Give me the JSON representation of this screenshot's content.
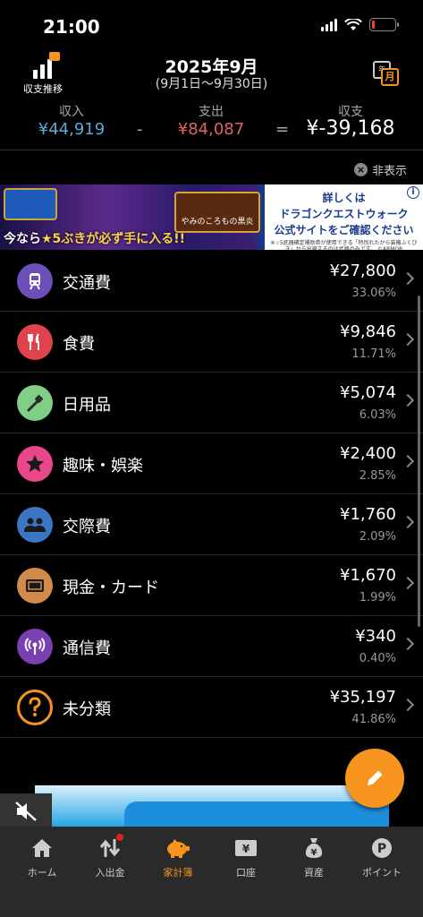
{
  "status_bar": {
    "time": "21:00"
  },
  "header": {
    "trend_label": "収支推移",
    "month_title": "2025年9月",
    "date_range": "(9月1日〜9月30日)",
    "calendar_back": "年",
    "calendar_front": "月"
  },
  "summary": {
    "income_label": "収入",
    "income_value": "¥44,919",
    "minus_sign": "-",
    "expense_label": "支出",
    "expense_value": "¥84,087",
    "equals_sign": "=",
    "balance_label": "収支",
    "balance_value": "¥-39,168"
  },
  "ad": {
    "hide_label": "非表示",
    "left_text_a": "今なら",
    "left_text_b": "★5ぶきが必ず手に入る!!",
    "badge_text": "やみのころもの黒炎",
    "right_line1": "詳しくは",
    "right_line2": "ドラゴンクエストウォーク",
    "right_line3": "公式サイトをご確認ください",
    "right_small": "※☆5武器確定補助券が使用できる「特別れたから装備ふくびき」から出現するのは武器のみです。 ©ARMOR PROJECT/BIRD STUDIO/SQUARE ENIX"
  },
  "categories": [
    {
      "name": "交通費",
      "amount": "¥27,800",
      "percent": "33.06%",
      "color": "#6a4fb8",
      "icon": "train-icon"
    },
    {
      "name": "食費",
      "amount": "¥9,846",
      "percent": "11.71%",
      "color": "#e0434b",
      "icon": "fork-knife-icon"
    },
    {
      "name": "日用品",
      "amount": "¥5,074",
      "percent": "6.03%",
      "color": "#7fcf86",
      "icon": "toothbrush-icon"
    },
    {
      "name": "趣味・娯楽",
      "amount": "¥2,400",
      "percent": "2.85%",
      "color": "#e8488a",
      "icon": "star-icon"
    },
    {
      "name": "交際費",
      "amount": "¥1,760",
      "percent": "2.09%",
      "color": "#3b76c4",
      "icon": "people-icon"
    },
    {
      "name": "現金・カード",
      "amount": "¥1,670",
      "percent": "1.99%",
      "color": "#d28a4a",
      "icon": "wallet-icon"
    },
    {
      "name": "通信費",
      "amount": "¥340",
      "percent": "0.40%",
      "color": "#7a3fb0",
      "icon": "antenna-icon"
    },
    {
      "name": "未分類",
      "amount": "¥35,197",
      "percent": "41.86%",
      "color": "#f7941d",
      "icon": "question-icon"
    }
  ],
  "tabs": [
    {
      "label": "ホーム",
      "icon": "home-icon"
    },
    {
      "label": "入出金",
      "icon": "transfer-icon"
    },
    {
      "label": "家計簿",
      "icon": "piggy-bank-icon"
    },
    {
      "label": "口座",
      "icon": "bank-account-icon"
    },
    {
      "label": "資産",
      "icon": "money-bag-icon"
    },
    {
      "label": "ポイント",
      "icon": "points-icon"
    }
  ],
  "colors": {
    "accent": "#f7941d",
    "income": "#5fa8d3",
    "expense": "#e06363"
  }
}
